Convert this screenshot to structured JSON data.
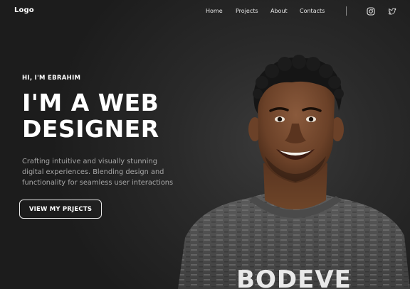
{
  "nav": {
    "logo": "Logo",
    "links": [
      "Home",
      "Projects",
      "About",
      "Contacts"
    ],
    "social_icons": [
      "instagram-icon",
      "twitter-icon"
    ]
  },
  "hero": {
    "greeting": "HI, I'M EBRAHIM",
    "headline_line1": "I'M A WEB",
    "headline_line2": "DESIGNER",
    "description_line1": "Crafting intuitive and visually stunning",
    "description_line2": "digital experiences. Blending design and",
    "description_line3": "functionality for seamless user interactions",
    "cta_label": "VIEW MY PRJECTS",
    "shirt_text": "BODEVE"
  },
  "colors": {
    "background": "#1f1f1f",
    "text_primary": "#ffffff",
    "text_secondary": "#a6a6a6",
    "accent_border": "#e8e8e8"
  }
}
